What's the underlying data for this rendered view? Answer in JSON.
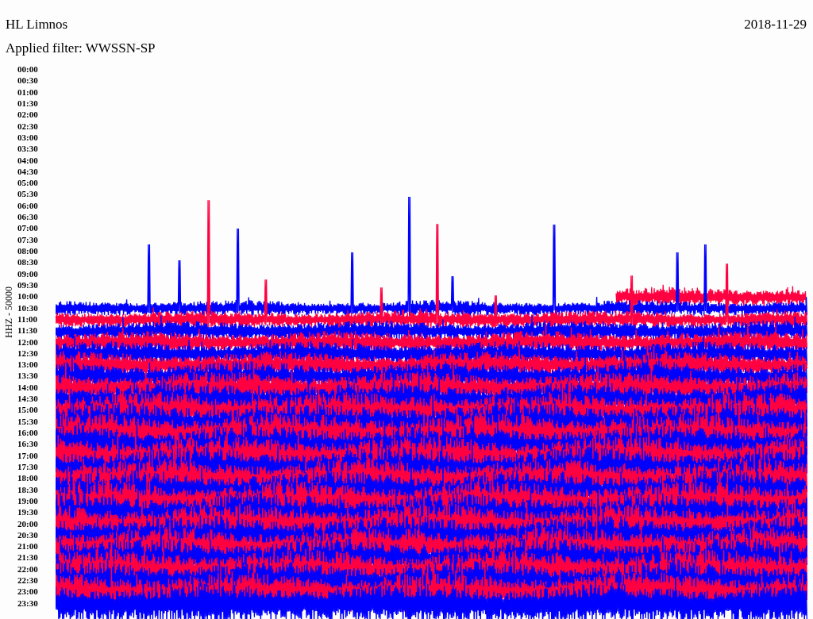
{
  "station": "HL Limnos",
  "date": "2018-11-29",
  "filter": "Applied filter: WWSSN-SP",
  "channel_label": "HHZ - 50000",
  "rows": [
    {
      "time": "00:00",
      "kind": "empty"
    },
    {
      "time": "00:30",
      "kind": "empty"
    },
    {
      "time": "01:00",
      "kind": "empty"
    },
    {
      "time": "01:30",
      "kind": "empty"
    },
    {
      "time": "02:00",
      "kind": "empty"
    },
    {
      "time": "02:30",
      "kind": "empty"
    },
    {
      "time": "03:00",
      "kind": "empty"
    },
    {
      "time": "03:30",
      "kind": "empty"
    },
    {
      "time": "04:00",
      "kind": "empty"
    },
    {
      "time": "04:30",
      "kind": "empty"
    },
    {
      "time": "05:00",
      "kind": "empty"
    },
    {
      "time": "05:30",
      "kind": "empty"
    },
    {
      "time": "06:00",
      "kind": "empty"
    },
    {
      "time": "06:30",
      "kind": "empty"
    },
    {
      "time": "07:00",
      "kind": "empty"
    },
    {
      "time": "07:30",
      "kind": "empty"
    },
    {
      "time": "08:00",
      "kind": "empty"
    },
    {
      "time": "08:30",
      "kind": "empty"
    },
    {
      "time": "09:00",
      "kind": "empty"
    },
    {
      "time": "09:30",
      "kind": "empty"
    },
    {
      "time": "10:00",
      "kind": "partial",
      "color": "#ff0040"
    },
    {
      "time": "10:30",
      "kind": "trace",
      "color": "#0000ff"
    },
    {
      "time": "11:00",
      "kind": "trace",
      "color": "#ff0040"
    },
    {
      "time": "11:30",
      "kind": "trace",
      "color": "#0000ff"
    },
    {
      "time": "12:00",
      "kind": "trace",
      "color": "#ff0040"
    },
    {
      "time": "12:30",
      "kind": "trace",
      "color": "#0000ff"
    },
    {
      "time": "13:00",
      "kind": "trace",
      "color": "#ff0040"
    },
    {
      "time": "13:30",
      "kind": "trace",
      "color": "#0000ff"
    },
    {
      "time": "14:00",
      "kind": "trace",
      "color": "#ff0040"
    },
    {
      "time": "14:30",
      "kind": "trace",
      "color": "#0000ff"
    },
    {
      "time": "15:00",
      "kind": "trace",
      "color": "#ff0040"
    },
    {
      "time": "15:30",
      "kind": "trace",
      "color": "#0000ff"
    },
    {
      "time": "16:00",
      "kind": "trace",
      "color": "#ff0040"
    },
    {
      "time": "16:30",
      "kind": "trace",
      "color": "#0000ff"
    },
    {
      "time": "17:00",
      "kind": "trace",
      "color": "#ff0040"
    },
    {
      "time": "17:30",
      "kind": "trace",
      "color": "#0000ff"
    },
    {
      "time": "18:00",
      "kind": "trace",
      "color": "#ff0040"
    },
    {
      "time": "18:30",
      "kind": "trace",
      "color": "#0000ff"
    },
    {
      "time": "19:00",
      "kind": "trace",
      "color": "#ff0040"
    },
    {
      "time": "19:30",
      "kind": "trace",
      "color": "#0000ff"
    },
    {
      "time": "20:00",
      "kind": "trace",
      "color": "#ff0040"
    },
    {
      "time": "20:30",
      "kind": "trace",
      "color": "#0000ff"
    },
    {
      "time": "21:00",
      "kind": "trace",
      "color": "#ff0040"
    },
    {
      "time": "21:30",
      "kind": "trace",
      "color": "#0000ff"
    },
    {
      "time": "22:00",
      "kind": "trace",
      "color": "#ff0040"
    },
    {
      "time": "22:30",
      "kind": "trace",
      "color": "#0000ff"
    },
    {
      "time": "23:00",
      "kind": "trace",
      "color": "#ff0040"
    },
    {
      "time": "23:30",
      "kind": "trace",
      "color": "#0000ff"
    }
  ]
}
